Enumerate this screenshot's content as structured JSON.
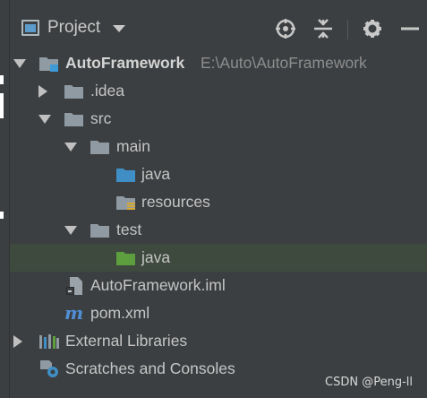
{
  "header": {
    "title": "Project",
    "tools": [
      "target-icon",
      "collapse-all-icon",
      "gear-icon",
      "minimize-icon"
    ]
  },
  "tree": {
    "root": {
      "label": "AutoFramework",
      "path": "E:\\Auto\\AutoFramework"
    },
    "idea": {
      "label": ".idea"
    },
    "src": {
      "label": "src"
    },
    "main": {
      "label": "main"
    },
    "main_java": {
      "label": "java"
    },
    "resources": {
      "label": "resources"
    },
    "test": {
      "label": "test"
    },
    "test_java": {
      "label": "java"
    },
    "iml": {
      "label": "AutoFramework.iml"
    },
    "pom": {
      "label": "pom.xml"
    },
    "external": {
      "label": "External Libraries"
    },
    "scratches": {
      "label": "Scratches and Consoles"
    }
  },
  "watermark": "CSDN @Peng-ll",
  "colors": {
    "background": "#3c3f41",
    "folder": "#8f9aa3",
    "source_folder": "#3f8fc6",
    "test_folder": "#5d9e3f",
    "selection": "#3e4a3e"
  }
}
